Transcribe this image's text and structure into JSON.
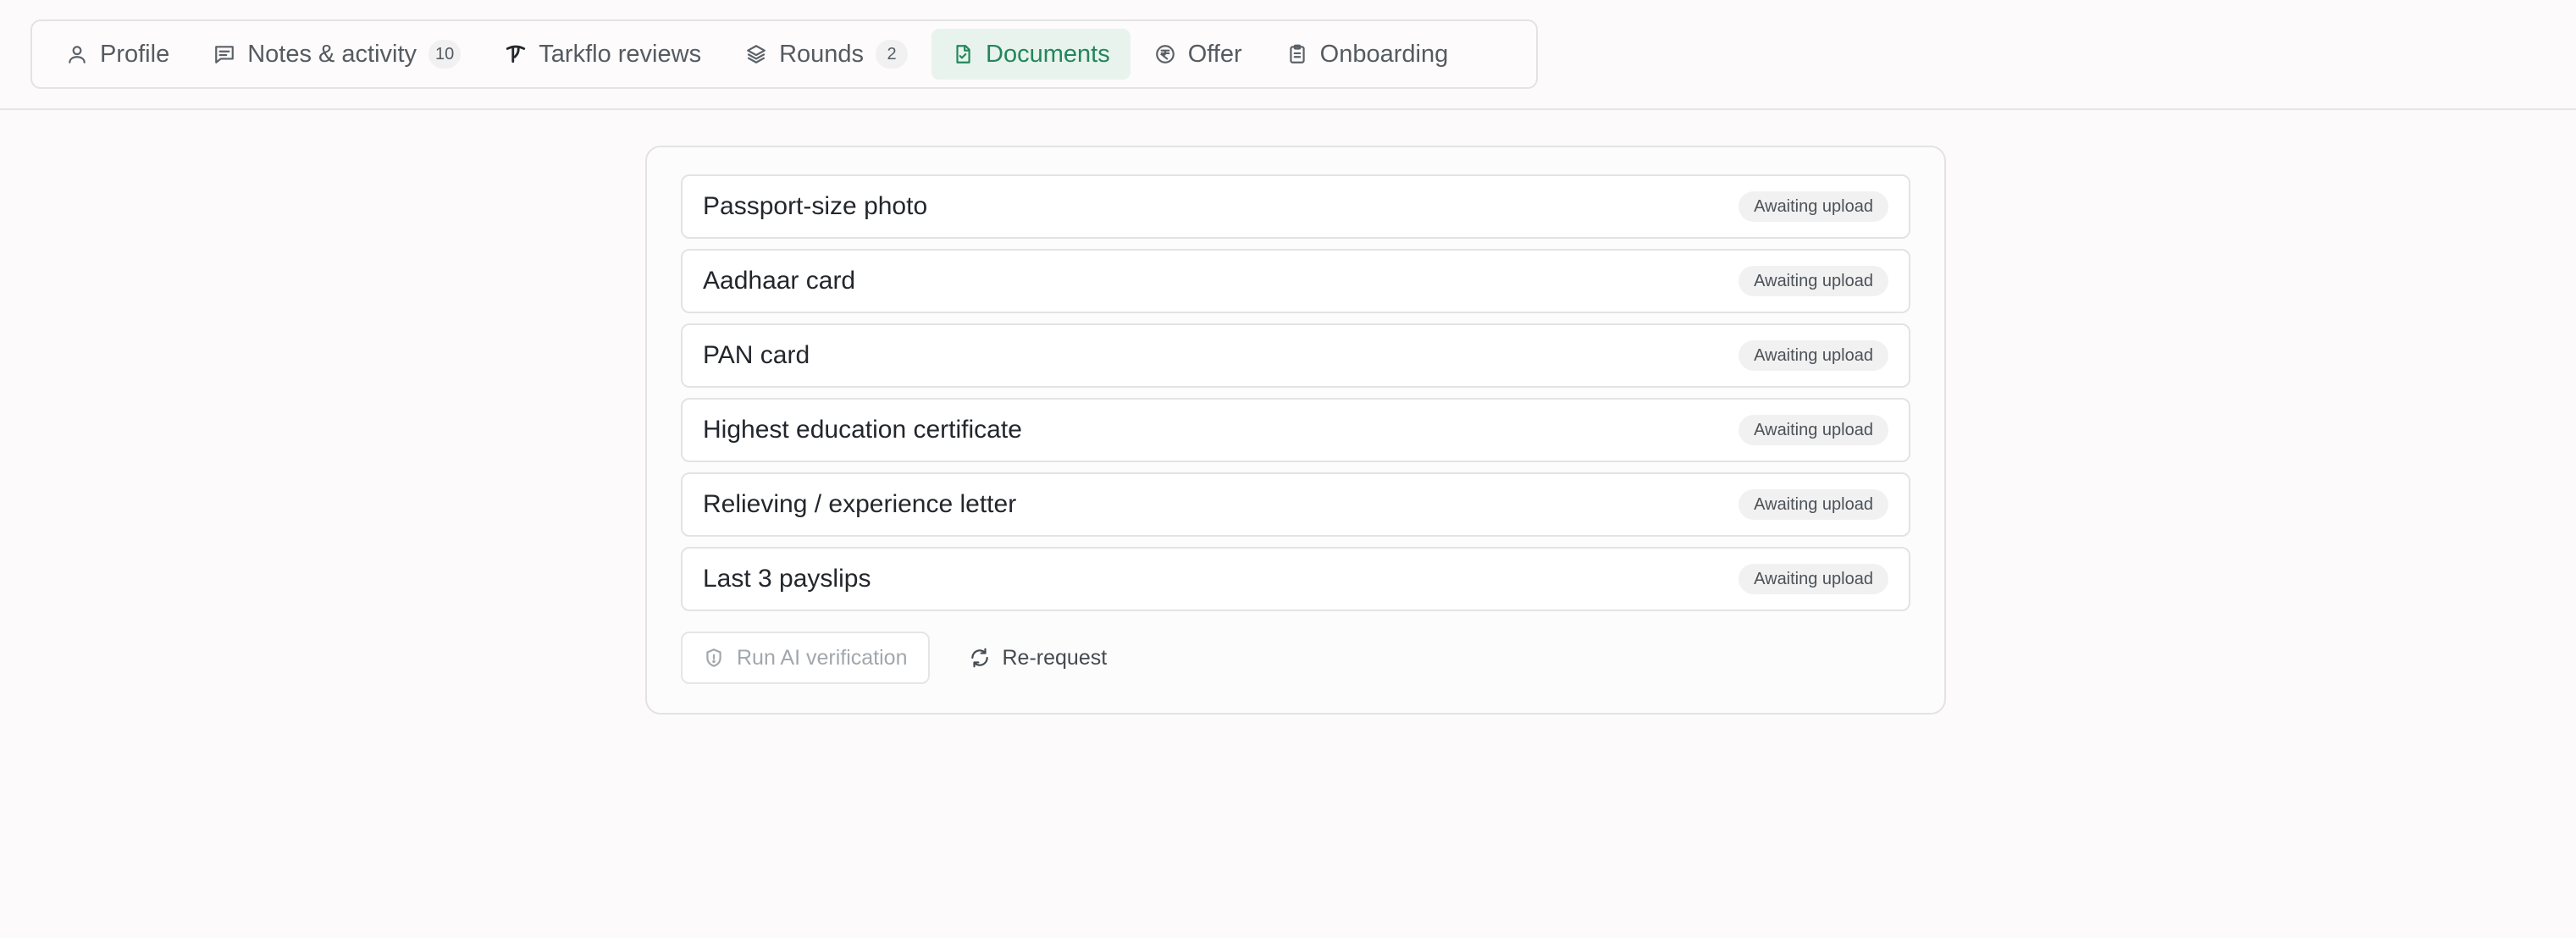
{
  "tabs": [
    {
      "label": "Profile",
      "icon": "person-icon"
    },
    {
      "label": "Notes & activity",
      "icon": "message-icon",
      "badge": "10"
    },
    {
      "label": "Tarkflo reviews",
      "icon": "tarkflo-logo-icon"
    },
    {
      "label": "Rounds",
      "icon": "layers-icon",
      "badge": "2"
    },
    {
      "label": "Documents",
      "icon": "document-check-icon",
      "active": true
    },
    {
      "label": "Offer",
      "icon": "rupee-circle-icon"
    },
    {
      "label": "Onboarding",
      "icon": "clipboard-icon"
    }
  ],
  "documents": [
    {
      "name": "Passport-size photo",
      "status": "Awaiting upload"
    },
    {
      "name": "Aadhaar card",
      "status": "Awaiting upload"
    },
    {
      "name": "PAN card",
      "status": "Awaiting upload"
    },
    {
      "name": "Highest education certificate",
      "status": "Awaiting upload"
    },
    {
      "name": "Relieving / experience letter",
      "status": "Awaiting upload"
    },
    {
      "name": "Last 3 payslips",
      "status": "Awaiting upload"
    }
  ],
  "actions": {
    "verify_label": "Run AI verification",
    "rerequest_label": "Re-request"
  },
  "colors": {
    "accent": "#23865a",
    "accent_bg": "#e8f3ee"
  }
}
